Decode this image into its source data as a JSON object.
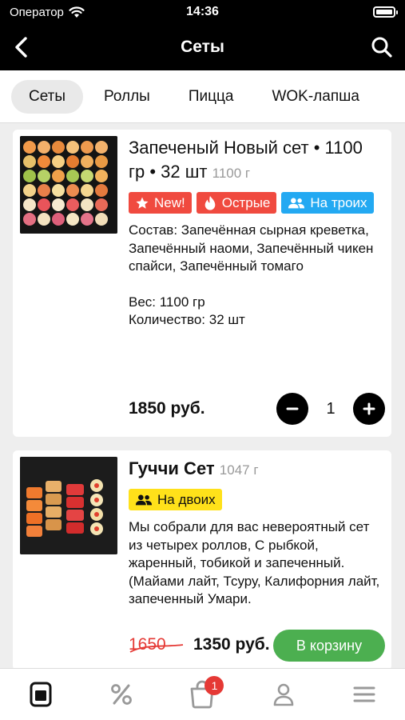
{
  "status_bar": {
    "carrier": "Оператор",
    "time": "14:36"
  },
  "header": {
    "title": "Сеты"
  },
  "tabs": [
    {
      "label": "Сеты",
      "active": true
    },
    {
      "label": "Роллы",
      "active": false
    },
    {
      "label": "Пицца",
      "active": false
    },
    {
      "label": "WOK-лапша",
      "active": false
    }
  ],
  "products": [
    {
      "title": "Запеченый Новый сет • 1100 гр • 32 шт",
      "weight_note": "1100 г",
      "tags": [
        {
          "label": "New!",
          "icon": "star-icon",
          "color": "#f04a3f"
        },
        {
          "label": "Острые",
          "icon": "flame-icon",
          "color": "#f04a3f"
        },
        {
          "label": "На троих",
          "icon": "people-icon",
          "color": "#23a9f2"
        }
      ],
      "description": "Состав: Запечённая сырная креветка, Запечённый наоми, Запечённый чикен спайси, Запечённый томаго",
      "weight_line": "Вес: 1100 гр",
      "count_line": "Количество: 32 шт",
      "price": "1850 руб.",
      "quantity": "1"
    },
    {
      "title": "Гуччи Сет",
      "weight_note": "1047 г",
      "tags": [
        {
          "label": "На двоих",
          "icon": "people-icon",
          "color": "#ffe11a"
        }
      ],
      "description": "Мы собрали для вас невероятный сет из четырех роллов, С рыбкой, жаренный, тобикой и запеченный. (Майами лайт, Тсуру, Калифорния лайт, запеченный Умари.",
      "old_price": "1650",
      "price": "1350 руб.",
      "cart_button": "В корзину"
    }
  ],
  "bottom_nav": {
    "cart_badge": "1",
    "items": [
      "menu-icon",
      "percent-icon",
      "cart-icon",
      "profile-icon",
      "hamburger-icon"
    ]
  },
  "colors": {
    "header_bg": "#000000",
    "tag_red": "#f04a3f",
    "tag_blue": "#23a9f2",
    "tag_yellow": "#ffe11a",
    "cart_green": "#4caf50",
    "badge_red": "#e53935"
  }
}
